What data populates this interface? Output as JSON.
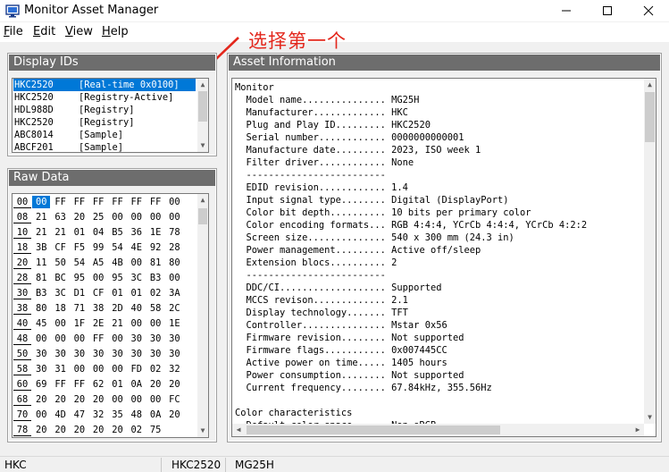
{
  "window": {
    "title": "Monitor Asset Manager"
  },
  "menu": [
    {
      "label": "File",
      "accel": "F",
      "rest": "ile"
    },
    {
      "label": "Edit",
      "accel": "E",
      "rest": "dit"
    },
    {
      "label": "View",
      "accel": "V",
      "rest": "iew"
    },
    {
      "label": "Help",
      "accel": "H",
      "rest": "elp"
    }
  ],
  "annotation": {
    "text": "选择第一个",
    "color": "#e3271c"
  },
  "display_ids": {
    "header": "Display IDs",
    "rows": [
      {
        "id": "HKC2520",
        "type": "[Real-time 0x0100]",
        "selected": true
      },
      {
        "id": "HKC2520",
        "type": "[Registry-Active]",
        "selected": false
      },
      {
        "id": "HDL988D",
        "type": "[Registry]",
        "selected": false
      },
      {
        "id": "HKC2520",
        "type": "[Registry]",
        "selected": false
      },
      {
        "id": "ABC8014",
        "type": "[Sample]",
        "selected": false
      },
      {
        "id": "ABCF201",
        "type": "[Sample]",
        "selected": false
      }
    ]
  },
  "raw_data": {
    "header": "Raw Data",
    "rows": [
      {
        "addr": "00",
        "bytes": [
          "00",
          "FF",
          "FF",
          "FF",
          "FF",
          "FF",
          "FF",
          "00"
        ]
      },
      {
        "addr": "08",
        "bytes": [
          "21",
          "63",
          "20",
          "25",
          "00",
          "00",
          "00",
          "00"
        ]
      },
      {
        "addr": "10",
        "bytes": [
          "21",
          "21",
          "01",
          "04",
          "B5",
          "36",
          "1E",
          "78"
        ]
      },
      {
        "addr": "18",
        "bytes": [
          "3B",
          "CF",
          "F5",
          "99",
          "54",
          "4E",
          "92",
          "28"
        ]
      },
      {
        "addr": "20",
        "bytes": [
          "11",
          "50",
          "54",
          "A5",
          "4B",
          "00",
          "81",
          "80"
        ]
      },
      {
        "addr": "28",
        "bytes": [
          "81",
          "BC",
          "95",
          "00",
          "95",
          "3C",
          "B3",
          "00"
        ]
      },
      {
        "addr": "30",
        "bytes": [
          "B3",
          "3C",
          "D1",
          "CF",
          "01",
          "01",
          "02",
          "3A"
        ]
      },
      {
        "addr": "38",
        "bytes": [
          "80",
          "18",
          "71",
          "38",
          "2D",
          "40",
          "58",
          "2C"
        ]
      },
      {
        "addr": "40",
        "bytes": [
          "45",
          "00",
          "1F",
          "2E",
          "21",
          "00",
          "00",
          "1E"
        ]
      },
      {
        "addr": "48",
        "bytes": [
          "00",
          "00",
          "00",
          "FF",
          "00",
          "30",
          "30",
          "30"
        ]
      },
      {
        "addr": "50",
        "bytes": [
          "30",
          "30",
          "30",
          "30",
          "30",
          "30",
          "30",
          "30"
        ]
      },
      {
        "addr": "58",
        "bytes": [
          "30",
          "31",
          "00",
          "00",
          "00",
          "FD",
          "02",
          "32"
        ]
      },
      {
        "addr": "60",
        "bytes": [
          "69",
          "FF",
          "FF",
          "62",
          "01",
          "0A",
          "20",
          "20"
        ]
      },
      {
        "addr": "68",
        "bytes": [
          "20",
          "20",
          "20",
          "20",
          "00",
          "00",
          "00",
          "FC"
        ]
      },
      {
        "addr": "70",
        "bytes": [
          "00",
          "4D",
          "47",
          "32",
          "35",
          "48",
          "0A",
          "20"
        ]
      },
      {
        "addr": "78",
        "bytes": [
          "20",
          "20",
          "20",
          "20",
          "20",
          "02",
          "75",
          ""
        ]
      }
    ]
  },
  "asset_info": {
    "header": "Asset Information",
    "lines": [
      "Monitor",
      "  Model name............... MG25H",
      "  Manufacturer............. HKC",
      "  Plug and Play ID......... HKC2520",
      "  Serial number............ 0000000000001",
      "  Manufacture date......... 2023, ISO week 1",
      "  Filter driver............ None",
      "  -------------------------",
      "  EDID revision............ 1.4",
      "  Input signal type........ Digital (DisplayPort)",
      "  Color bit depth.......... 10 bits per primary color",
      "  Color encoding formats... RGB 4:4:4, YCrCb 4:4:4, YCrCb 4:2:2",
      "  Screen size.............. 540 x 300 mm (24.3 in)",
      "  Power management......... Active off/sleep",
      "  Extension blocs.......... 2",
      "  -------------------------",
      "  DDC/CI................... Supported",
      "  MCCS revison............. 2.1",
      "  Display technology....... TFT",
      "  Controller............... Mstar 0x56",
      "  Firmware revision........ Not supported",
      "  Firmware flags........... 0x007445CC",
      "  Active power on time..... 1405 hours",
      "  Power consumption........ Not supported",
      "  Current frequency........ 67.84kHz, 355.56Hz",
      "",
      "Color characteristics",
      "  Default color space...... Non-sRGB"
    ]
  },
  "status": {
    "manufacturer": "HKC",
    "pnp_id": "HKC2520",
    "model": "MG25H"
  }
}
